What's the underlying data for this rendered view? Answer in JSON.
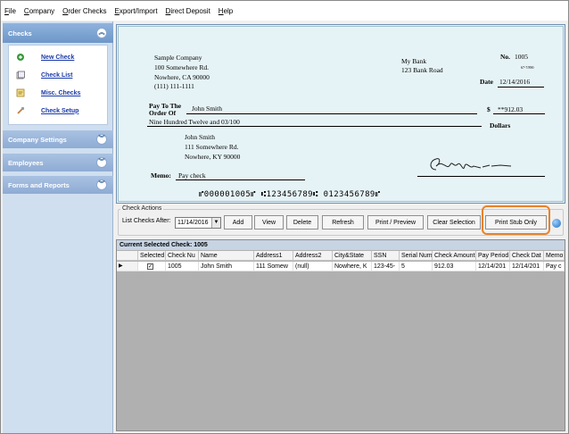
{
  "menu": [
    "File",
    "Company",
    "Order Checks",
    "Export/Import",
    "Direct Deposit",
    "Help"
  ],
  "menu_underline": [
    "F",
    "C",
    "O",
    "E",
    "D",
    "H"
  ],
  "sidebar": {
    "checks_header": "Checks",
    "items": [
      {
        "label": "New Check",
        "icon": "new-check-icon"
      },
      {
        "label": "Check List",
        "icon": "check-list-icon"
      },
      {
        "label": "Misc. Checks",
        "icon": "misc-checks-icon"
      },
      {
        "label": "Check Setup",
        "icon": "check-setup-icon"
      }
    ],
    "sections": [
      "Company Settings",
      "Employees",
      "Forms and Reports"
    ]
  },
  "check": {
    "company_name": "Sample Company",
    "company_addr1": "100 Somewhere Rd.",
    "company_addr2": "Nowhere, CA 90000",
    "company_phone": "(111) 111-1111",
    "bank_name": "My Bank",
    "bank_addr": "123 Bank Road",
    "no_label": "No.",
    "check_no": "1005",
    "fraction": "67-7/890",
    "date_label": "Date",
    "date": "12/14/2016",
    "pay_to_label_1": "Pay To The",
    "pay_to_label_2": "Order Of",
    "payee": "John Smith",
    "dollar_sign": "$",
    "amount": "**912.03",
    "amount_words": "Nine Hundred Twelve and 03/100",
    "dollars_label": "Dollars",
    "addr_name": "John Smith",
    "addr1": "111 Somewhere Rd.",
    "addr2": "Nowhere, KY 90000",
    "memo_label": "Memo:",
    "memo": "Pay check",
    "micr": "⑈000001005⑈ ⑆123456789⑆ 0123456789⑈"
  },
  "actions": {
    "legend": "Check Actions",
    "list_after_label": "List Checks After:",
    "list_after_value": "11/14/2016",
    "buttons": {
      "add": "Add",
      "view": "View",
      "delete": "Delete",
      "refresh": "Refresh",
      "print_preview": "Print / Preview",
      "clear_selection": "Clear Selection",
      "print_stub": "Print Stub Only"
    }
  },
  "grid": {
    "title": "Current Selected Check: 1005",
    "columns": [
      "Selected",
      "Check Nu",
      "Name",
      "Address1",
      "Address2",
      "City&State",
      "SSN",
      "Serial Num",
      "Check Amount",
      "Pay Period",
      "Check Dat",
      "Memo"
    ],
    "row": {
      "selected": "✓",
      "check_no": "1005",
      "name": "John Smith",
      "address1": "111 Somew",
      "address2": "(null)",
      "city_state": "Nowhere, K",
      "ssn": "123-45-",
      "serial": "5",
      "amount": "912.03",
      "pay_period": "12/14/201",
      "check_date": "12/14/201",
      "memo": "Pay c"
    },
    "row_pointer": "▶"
  },
  "colors": {
    "sidebar_bg": "#cfdff0",
    "sidebar_header": "#6d97c9",
    "check_bg": "#e6f3f6",
    "link": "#1a3aa8",
    "highlight": "#e8822b"
  }
}
